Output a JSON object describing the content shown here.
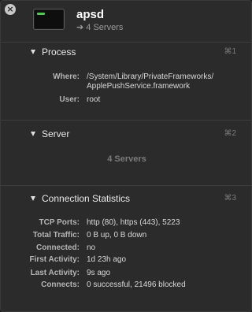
{
  "window": {
    "close_glyph": "×"
  },
  "header": {
    "app_name": "apsd",
    "subtitle": "➔ 4 Servers"
  },
  "process": {
    "title": "Process",
    "shortcut": "⌘1",
    "rows": [
      {
        "label": "Where:",
        "value_line1": "/System/Library/PrivateFrameworks/",
        "value_line2": "ApplePushService.framework"
      },
      {
        "label": "User:",
        "value": "root"
      }
    ]
  },
  "server": {
    "title": "Server",
    "shortcut": "⌘2",
    "count_text": "4 Servers"
  },
  "connection": {
    "title": "Connection Statistics",
    "shortcut": "⌘3",
    "rows": [
      {
        "label": "TCP Ports:",
        "value": "http (80), https (443), 5223"
      },
      {
        "label": "Total Traffic:",
        "value": "0 B up, 0 B down"
      },
      {
        "label": "Connected:",
        "value": "no"
      },
      {
        "label": "First Activity:",
        "value": "1d 23h ago"
      },
      {
        "label": "Last Activity:",
        "value": "9s ago"
      },
      {
        "label": "Connects:",
        "value": "0 successful, 21496 blocked"
      }
    ]
  },
  "colors": {
    "background": "#2b2b2b",
    "terminal_green": "#4fc94f"
  },
  "icons": [
    "close-icon",
    "terminal-app-icon",
    "arrow-right-icon",
    "disclosure-triangle-icon"
  ]
}
